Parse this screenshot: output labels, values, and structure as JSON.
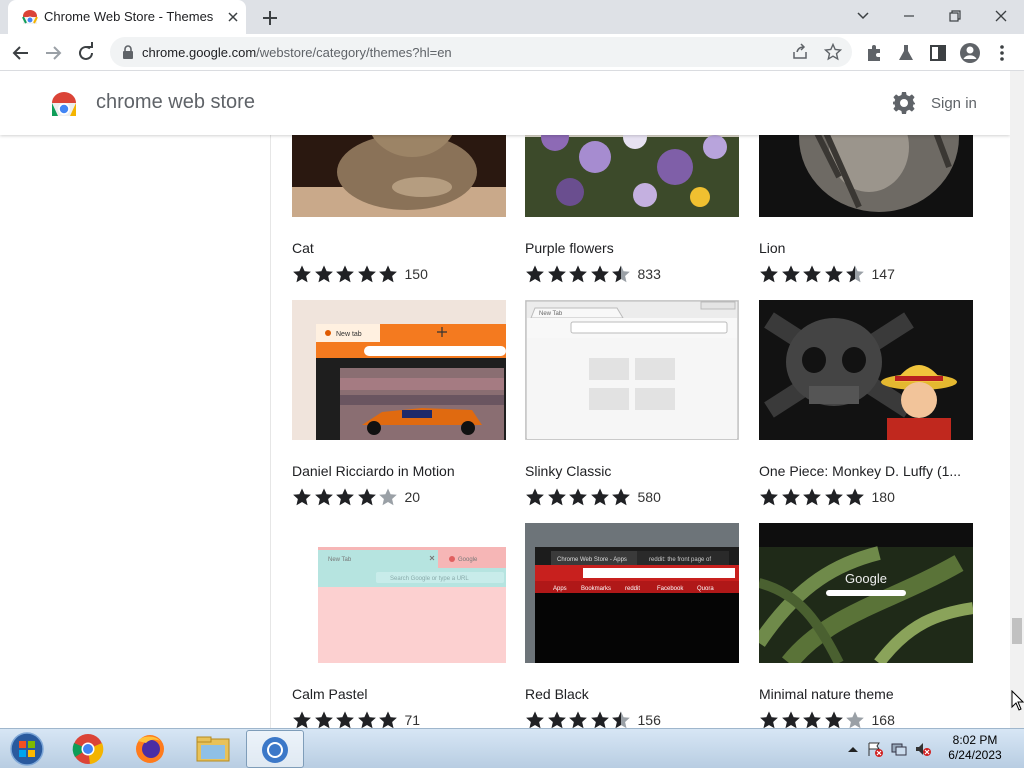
{
  "browser": {
    "tab_title": "Chrome Web Store - Themes",
    "url_host": "chrome.google.com",
    "url_path": "/webstore/category/themes?hl=en"
  },
  "store": {
    "title": "chrome web store",
    "sign_in": "Sign in"
  },
  "themes": [
    {
      "name": "Cat",
      "stars": 5,
      "count": "150"
    },
    {
      "name": "Purple flowers",
      "stars": 4.5,
      "count": "833"
    },
    {
      "name": "Lion",
      "stars": 4.5,
      "count": "147"
    },
    {
      "name": "Daniel Ricciardo in Motion",
      "stars": 4,
      "count": "20"
    },
    {
      "name": "Slinky Classic",
      "stars": 5,
      "count": "580"
    },
    {
      "name": "One Piece: Monkey D. Luffy (1...",
      "stars": 5,
      "count": "180"
    },
    {
      "name": "Calm Pastel",
      "stars": 5,
      "count": "71"
    },
    {
      "name": "Red Black",
      "stars": 4.5,
      "count": "156"
    },
    {
      "name": "Minimal nature theme",
      "stars": 4,
      "count": "168"
    }
  ],
  "thumbnail_text": {
    "ricciardo_tab": "New tab",
    "slinky_tab": "New Tab",
    "pastel_tab": "New Tab",
    "pastel_tab2": "Google",
    "pastel_search": "Search Google or type a URL",
    "redblack_tab": "Chrome Web Store - Apps",
    "redblack_tab2": "reddit: the front page of",
    "redblack_bm1": "Apps",
    "redblack_bm2": "Bookmarks",
    "redblack_bm3": "reddit",
    "redblack_bm4": "Facebook",
    "redblack_bm5": "Quora",
    "nature_logo": "Google"
  },
  "taskbar": {
    "time": "8:02 PM",
    "date": "6/24/2023"
  },
  "colors": {
    "star": "#202124",
    "star_empty": "#9aa0a6",
    "accent": "#1a73e8"
  }
}
